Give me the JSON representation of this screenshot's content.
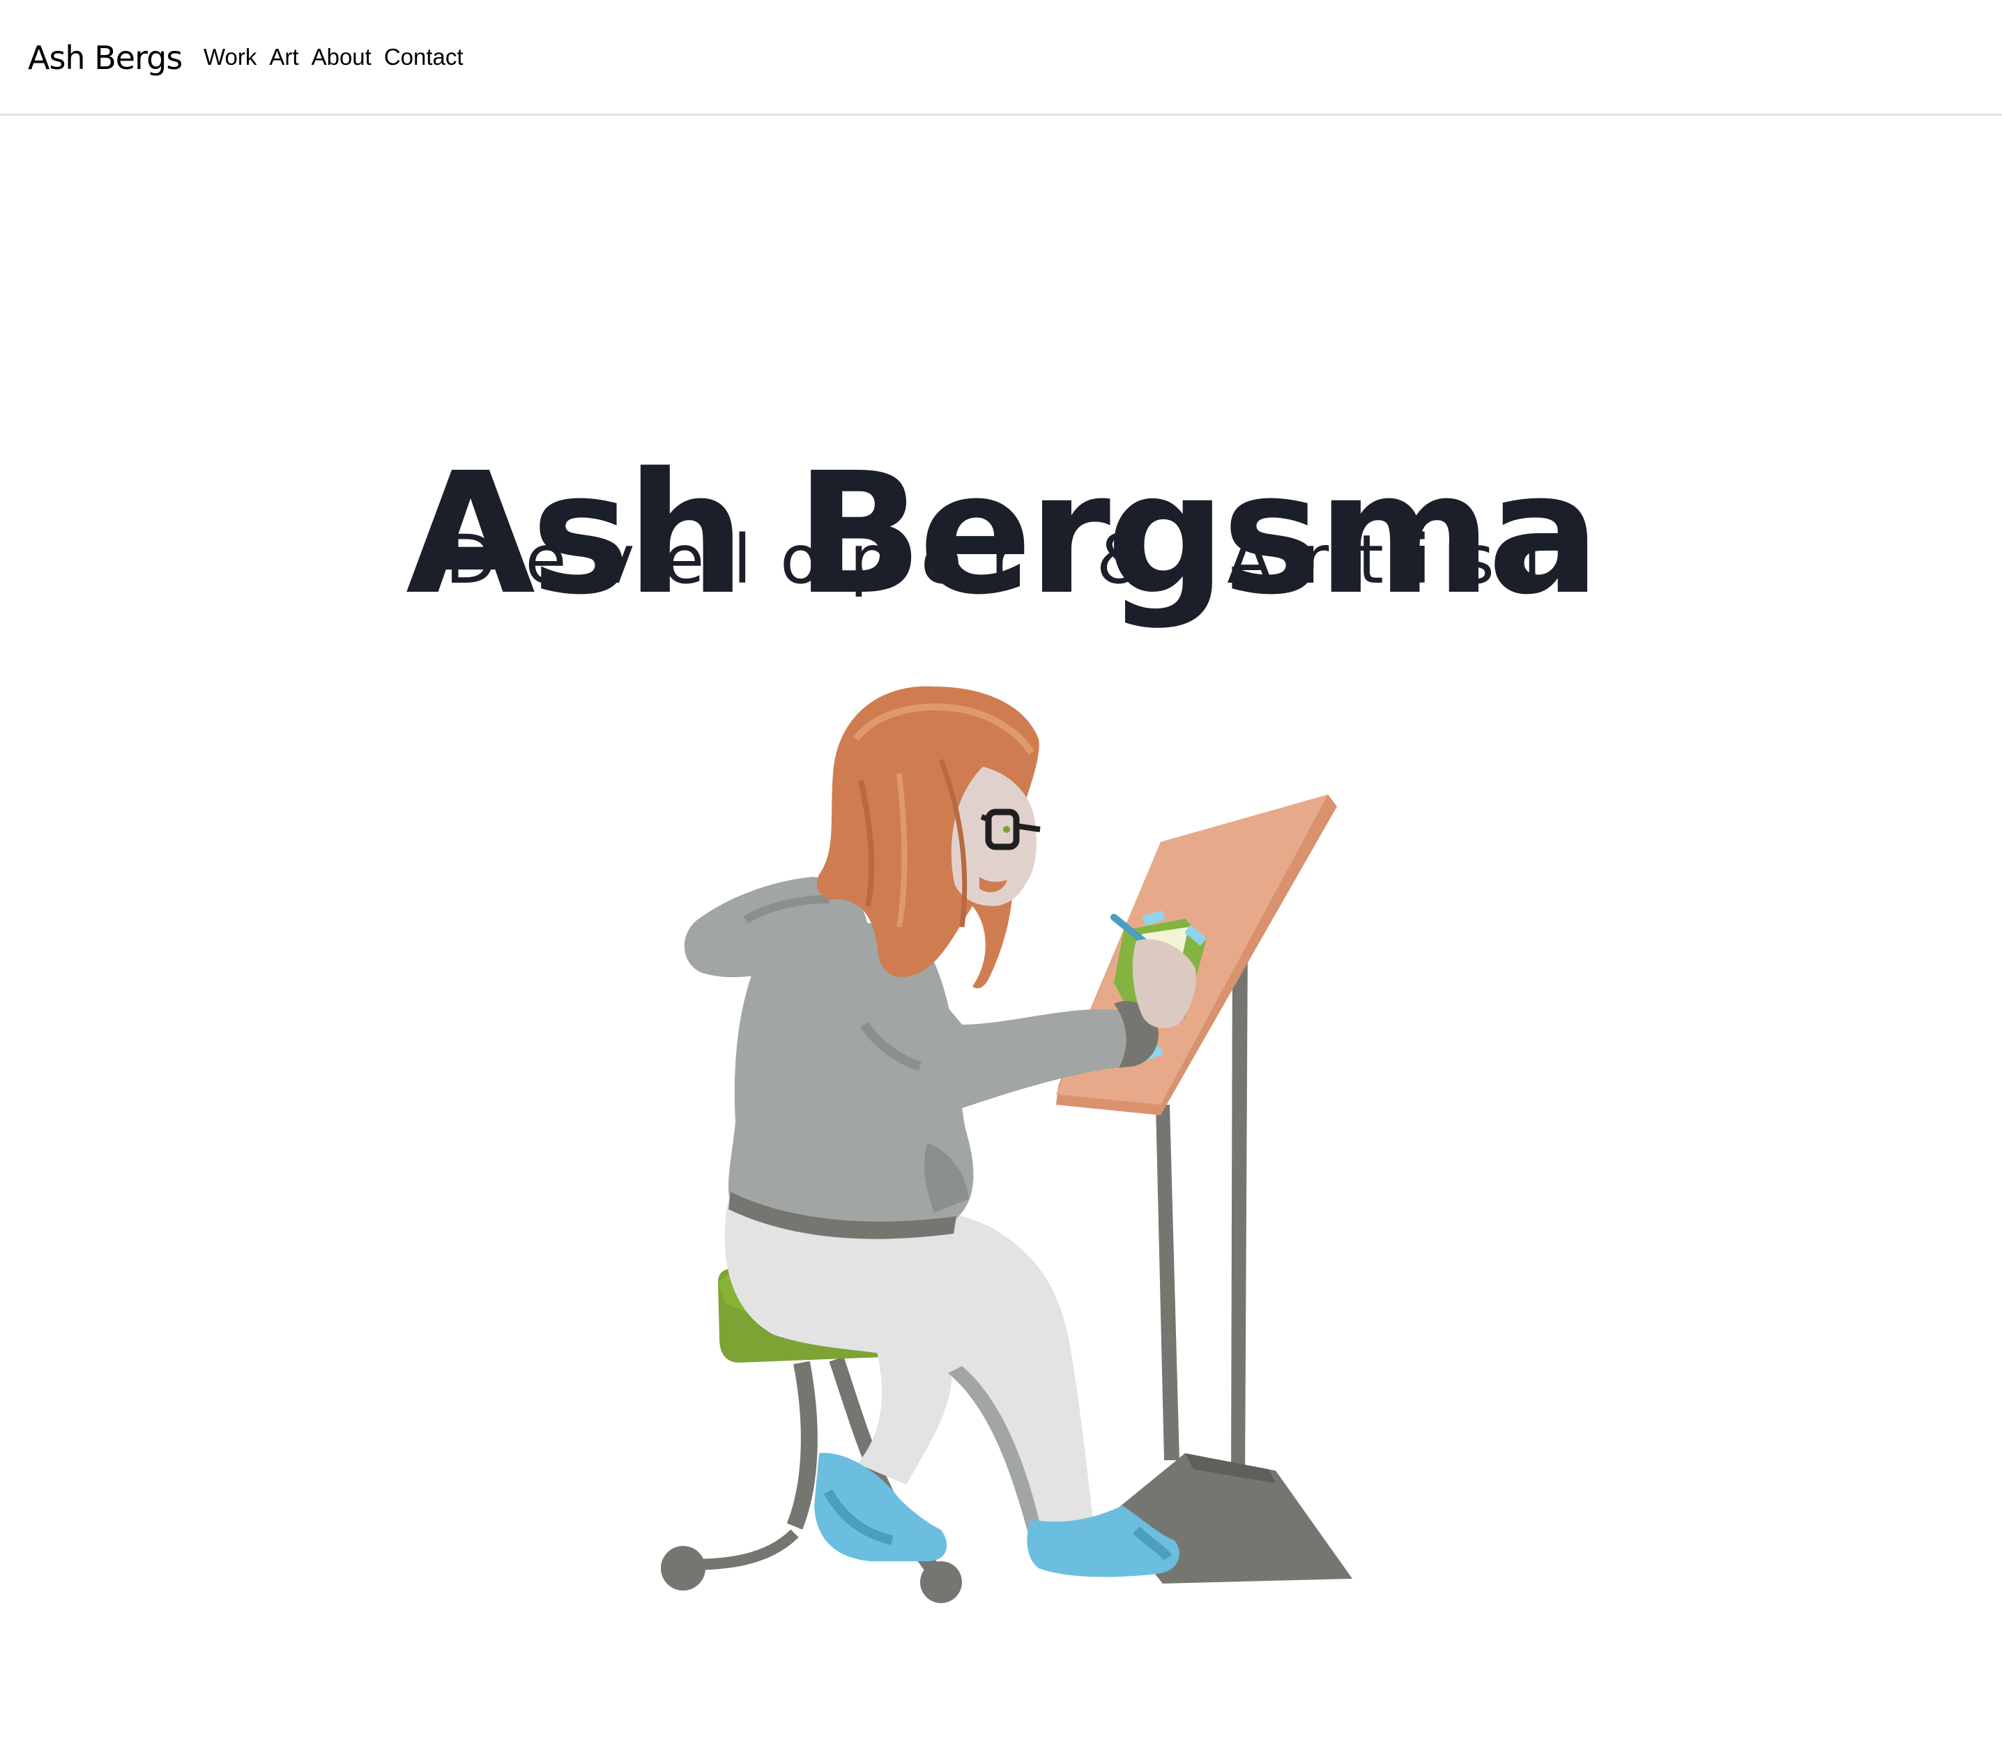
{
  "header": {
    "brand": "Ash Bergs",
    "nav": [
      {
        "label": "Work"
      },
      {
        "label": "Art"
      },
      {
        "label": "About"
      },
      {
        "label": "Contact"
      }
    ]
  },
  "hero": {
    "title": "Ash Bergsma",
    "subtitle": "Developer & Artist"
  },
  "colors": {
    "text": "#1b1f2a",
    "hair": "#cf7d50",
    "hoodie": "#a1a6a5",
    "pants": "#e3e3e3",
    "shoes": "#6bbedf",
    "stool_seat": "#7ca334",
    "metal": "#767670",
    "board": "#e6aa8a"
  }
}
